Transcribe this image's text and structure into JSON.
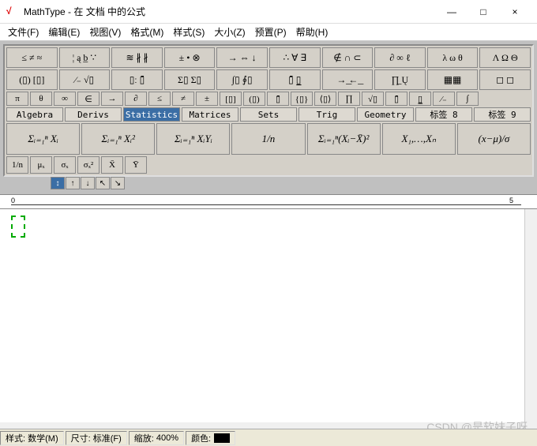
{
  "window": {
    "title": "MathType - 在 文档 中的公式",
    "minimize": "—",
    "maximize": "□",
    "close": "×"
  },
  "menu": [
    "文件(F)",
    "编辑(E)",
    "视图(V)",
    "格式(M)",
    "样式(S)",
    "大小(Z)",
    "预置(P)",
    "帮助(H)"
  ],
  "row1": [
    "≤ ≠ ≈",
    "¦ ą b̲ ∵",
    "≋ ∦ ∦",
    "± • ⊗",
    "→ ⇔ ↓",
    "∴ ∀ ∃",
    "∉ ∩ ⊂",
    "∂ ∞ ℓ",
    "λ ω θ",
    "Λ Ω Θ"
  ],
  "row2": [
    "(▯) [▯]",
    "⁄₋ √▯",
    "▯ː ▯̄",
    "Σ▯ Σ▯",
    "∫▯ ∮▯",
    "▯̄ ▯̲",
    "→͟ ←͟",
    "∏̲ Ų",
    "▦▦",
    "◻ ◻"
  ],
  "row3": [
    "π",
    "θ",
    "∞",
    "∈",
    "→",
    "∂",
    "≤",
    "≠",
    "±",
    "[▯]",
    "(▯)",
    "▯̄",
    "{▯}",
    "⟨▯⟩",
    "∏",
    "√▯",
    "▯̄",
    "▯̲",
    "⁄₋",
    "∫"
  ],
  "tabs": [
    "Algebra",
    "Derivs",
    "Statistics",
    "Matrices",
    "Sets",
    "Trig",
    "Geometry",
    "标签 8",
    "标签 9"
  ],
  "tab_selected": 2,
  "samples": [
    "Σᵢ₌₁ⁿ Xᵢ",
    "Σᵢ₌₁ⁿ Xᵢ²",
    "Σᵢ₌₁ⁿ XᵢYᵢ",
    "1/n",
    "Σᵢ₌₁ⁿ(Xᵢ−X̄)²",
    "X₁,…,Xₙ",
    "(x−μ)/σ"
  ],
  "samples2": [
    "1/n",
    "μₓ",
    "σₓ",
    "σₓ²",
    "X̄",
    "Ȳ"
  ],
  "nav": [
    "↕",
    "↑",
    "↓",
    "↖",
    "↘"
  ],
  "ruler": {
    "start": "0",
    "end": "5"
  },
  "status": {
    "style_label": "样式:",
    "style_val": "数学(M)",
    "size_label": "尺寸:",
    "size_val": "标准(F)",
    "zoom_label": "缩放:",
    "zoom_val": "400%",
    "color_label": "颜色:"
  },
  "watermark": "CSDN @是软妹子呀"
}
